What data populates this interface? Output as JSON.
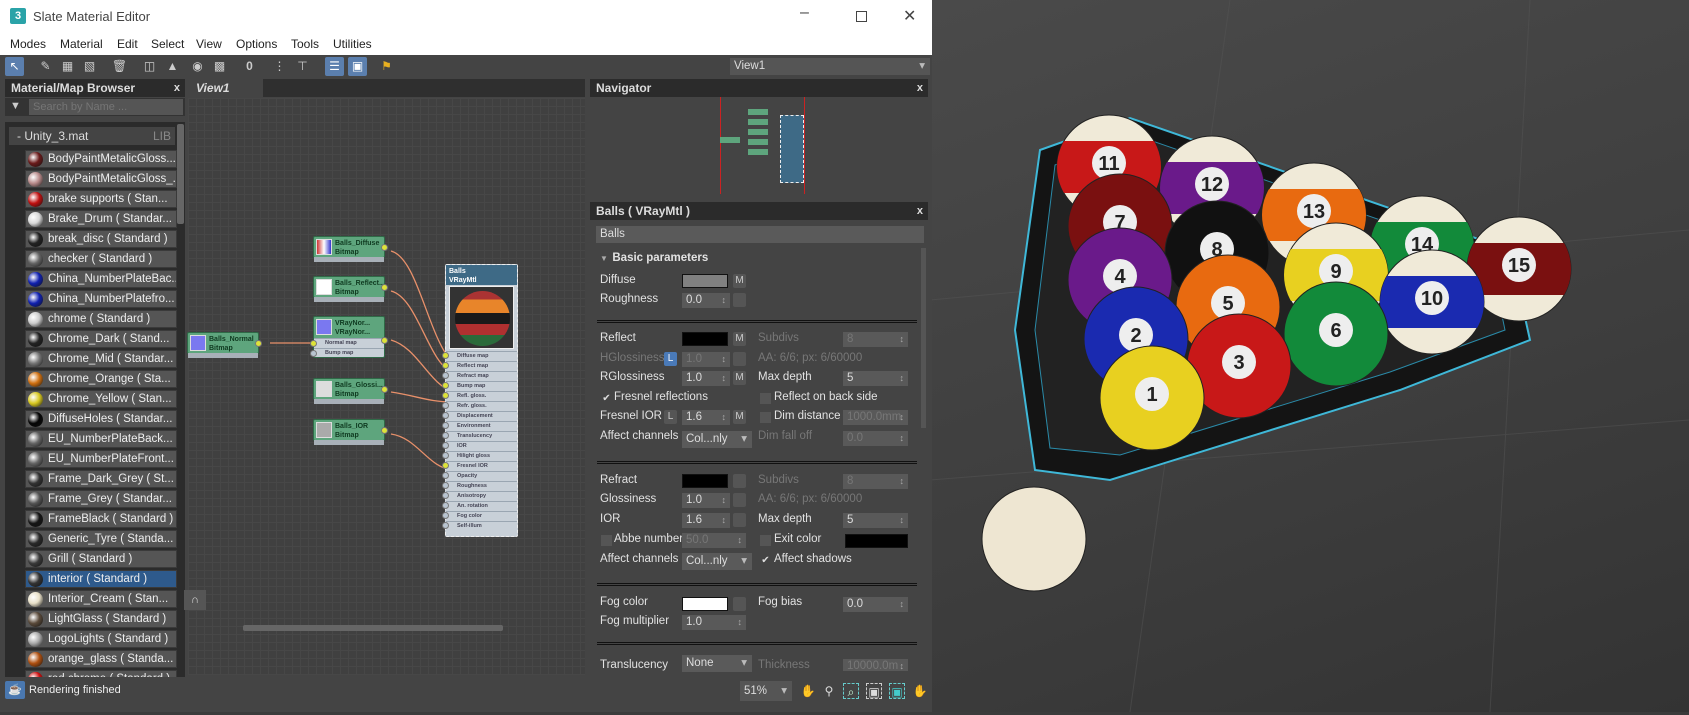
{
  "window": {
    "title": "Slate Material Editor",
    "app_icon": "3"
  },
  "menu": [
    "Modes",
    "Material",
    "Edit",
    "Select",
    "View",
    "Options",
    "Tools",
    "Utilities"
  ],
  "toolbar": {
    "view_select": "View1"
  },
  "browser": {
    "title": "Material/Map Browser",
    "close": "x",
    "search_placeholder": "Search by Name ...",
    "library": "Unity_3.mat",
    "library_tag": "LIB",
    "items": [
      {
        "label": "BodyPaintMetalicGloss...",
        "color": "#6a1a1a"
      },
      {
        "label": "BodyPaintMetalicGloss_...",
        "color": "#b88a8a"
      },
      {
        "label": "brake supports  ( Stan...",
        "color": "#c01010"
      },
      {
        "label": "Brake_Drum  ( Standar...",
        "color": "#d8d8d8"
      },
      {
        "label": "break_disc  ( Standard )",
        "color": "#222"
      },
      {
        "label": "checker  ( Standard )",
        "color": "#666"
      },
      {
        "label": "China_NumberPlateBac...",
        "color": "#1020b0"
      },
      {
        "label": "China_NumberPlatefro...",
        "color": "#1020b0"
      },
      {
        "label": "chrome  ( Standard )",
        "color": "#ccc"
      },
      {
        "label": "Chrome_Dark  ( Stand...",
        "color": "#222"
      },
      {
        "label": "Chrome_Mid  ( Standar...",
        "color": "#777"
      },
      {
        "label": "Chrome_Orange  ( Sta...",
        "color": "#d07010"
      },
      {
        "label": "Chrome_Yellow  ( Stan...",
        "color": "#d8c820"
      },
      {
        "label": "DiffuseHoles  ( Standar...",
        "color": "#050505"
      },
      {
        "label": "EU_NumberPlateBack...",
        "color": "#666"
      },
      {
        "label": "EU_NumberPlateFront...",
        "color": "#666"
      },
      {
        "label": "Frame_Dark_Grey  ( St...",
        "color": "#333"
      },
      {
        "label": "Frame_Grey  ( Standar...",
        "color": "#555"
      },
      {
        "label": "FrameBlack  ( Standard )",
        "color": "#151515"
      },
      {
        "label": "Generic_Tyre  ( Standa...",
        "color": "#2a2a2a"
      },
      {
        "label": "Grill  ( Standard )",
        "color": "#3a3a3a"
      },
      {
        "label": "interior  ( Standard )",
        "color": "#333",
        "selected": true
      },
      {
        "label": "Interior_Cream  ( Stan...",
        "color": "#e8e0c8"
      },
      {
        "label": "LightGlass  ( Standard )",
        "color": "#5a4a3a"
      },
      {
        "label": "LogoLights  ( Standard )",
        "color": "#aaa"
      },
      {
        "label": "orange_glass  ( Standa...",
        "color": "#b05010"
      },
      {
        "label": "red chrome  ( Standard )",
        "color": "#d01010"
      }
    ]
  },
  "view": {
    "tab": "View1",
    "nodes": {
      "normal": {
        "name": "Balls_Normal",
        "type": "Bitmap"
      },
      "diffuse": {
        "name": "Balls_Diffuse",
        "type": "Bitmap"
      },
      "reflect": {
        "name": "Balls_Reflect...",
        "type": "Bitmap"
      },
      "vraynormal": {
        "name": "VRayNor...",
        "type": "VRayNor...",
        "slots": [
          "Normal map",
          "Bump map"
        ]
      },
      "gloss": {
        "name": "Balls_Glossi...",
        "type": "Bitmap"
      },
      "ior": {
        "name": "Balls_IOR",
        "type": "Bitmap"
      },
      "material": {
        "name": "Balls",
        "type": "VRayMtl",
        "slots": [
          "Diffuse map",
          "Reflect map",
          "Refract map",
          "Bump map",
          "Refl. gloss.",
          "Refr. gloss.",
          "Displacement",
          "Environment",
          "Translucency",
          "IOR",
          "Hilight gloss",
          "Fresnel IOR",
          "Opacity",
          "Roughness",
          "Anisotropy",
          "An. rotation",
          "Fog color",
          "Self-illum"
        ],
        "connected": [
          0,
          1,
          3,
          4,
          11
        ]
      }
    }
  },
  "navigator": {
    "title": "Navigator",
    "close": "x"
  },
  "params": {
    "title": "Balls  ( VRayMtl )",
    "close": "x",
    "name": "Balls",
    "rollout": "Basic parameters",
    "diffuse": {
      "label": "Diffuse",
      "color": "#808080",
      "m": "M"
    },
    "roughness": {
      "label": "Roughness",
      "value": "0.0"
    },
    "reflect": {
      "label": "Reflect",
      "color": "#000000",
      "m": "M"
    },
    "hgloss": {
      "label": "HGlossiness",
      "lock": "L",
      "value": "1.0"
    },
    "rgloss": {
      "label": "RGlossiness",
      "value": "1.0",
      "m": "M"
    },
    "fresnel": {
      "label": "Fresnel reflections",
      "checked": true
    },
    "fresnel_ior": {
      "label": "Fresnel IOR",
      "lock": "L",
      "value": "1.6",
      "m": "M"
    },
    "affect_refl": {
      "label": "Affect channels",
      "value": "Col...nly"
    },
    "refl_subdivs": {
      "label": "Subdivs",
      "value": "8"
    },
    "refl_aa": "AA: 6/6; px: 6/60000",
    "refl_maxdepth": {
      "label": "Max depth",
      "value": "5"
    },
    "back_side": {
      "label": "Reflect on back side",
      "checked": false
    },
    "dim_distance": {
      "label": "Dim distance",
      "value": "1000.0mm",
      "checked": false
    },
    "dim_falloff": {
      "label": "Dim fall off",
      "value": "0.0"
    },
    "refract": {
      "label": "Refract",
      "color": "#000000"
    },
    "glossiness": {
      "label": "Glossiness",
      "value": "1.0"
    },
    "ior": {
      "label": "IOR",
      "value": "1.6"
    },
    "abbe": {
      "label": "Abbe number",
      "value": "50.0",
      "checked": false
    },
    "affect_refr": {
      "label": "Affect channels",
      "value": "Col...nly"
    },
    "refr_subdivs": {
      "label": "Subdivs",
      "value": "8"
    },
    "refr_aa": "AA: 6/6; px: 6/60000",
    "refr_maxdepth": {
      "label": "Max depth",
      "value": "5"
    },
    "exit_color": {
      "label": "Exit color",
      "color": "#000000",
      "checked": false
    },
    "affect_shadows": {
      "label": "Affect shadows",
      "checked": true
    },
    "fog_color": {
      "label": "Fog color",
      "color": "#ffffff"
    },
    "fog_mult": {
      "label": "Fog multiplier",
      "value": "1.0"
    },
    "fog_bias": {
      "label": "Fog bias",
      "value": "0.0"
    },
    "translucency": {
      "label": "Translucency",
      "value": "None"
    },
    "thickness": {
      "label": "Thickness",
      "value": "10000.0m"
    }
  },
  "status": {
    "text": "Rendering finished",
    "zoom": "51%"
  },
  "scene": {
    "balls": [
      "1",
      "2",
      "3",
      "4",
      "5",
      "6",
      "7",
      "8",
      "9",
      "10",
      "11",
      "12",
      "13",
      "14",
      "15"
    ]
  }
}
